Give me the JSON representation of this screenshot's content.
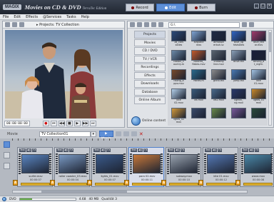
{
  "app": {
    "logo": "MAGIX",
    "title": "Movies on CD & DVD",
    "edition": "TerraTec Edition",
    "modes": [
      {
        "label": "Record",
        "active": false
      },
      {
        "label": "Edit",
        "active": true
      },
      {
        "label": "Burn",
        "active": false
      }
    ]
  },
  "menu": [
    "File",
    "Edit",
    "Effects",
    "@Services",
    "Tasks",
    "Help"
  ],
  "preview": {
    "breadcrumb": "▸ Projects: TV Collection",
    "timecode": "00:00:00:00",
    "transport": [
      "●",
      "⏮",
      "◀◀",
      "■",
      "▶",
      "▶▶",
      "⏭"
    ]
  },
  "pool": {
    "path": "G:\\",
    "categories": [
      "Projects",
      "Movies",
      "CD / DVD",
      "TV / VCR",
      "Recordings",
      "Effects",
      "Downloads",
      "Database",
      "Online Album"
    ],
    "active_category": "Projects",
    "online_label": "Online content",
    "files": [
      {
        "name": "3d_cars",
        "ext": "slides",
        "color": "#2b4a7a"
      },
      {
        "name": "airplane",
        "ext": "ntxs",
        "color": "#7fa5d4"
      },
      {
        "name": "atmosph",
        "ext": "erbuh.sc",
        "color": "#1f2a44"
      },
      {
        "name": "blue_lig",
        "ext": "htshades",
        "color": "#3066c4"
      },
      {
        "name": "blue_red",
        "ext": "ar.mxv",
        "color": "#a23c6c"
      },
      {
        "name": "classic_c",
        "ext": "ountry.m",
        "color": "#6c8aa8"
      },
      {
        "name": "colored_",
        "ext": "flakes.mxv",
        "color": "#c45a2a"
      },
      {
        "name": "crossing",
        "ext": "line.mxv",
        "color": "#5a6470"
      },
      {
        "name": "drive.mv",
        "ext": "",
        "color": "#8aa0b8"
      },
      {
        "name": "driving_a",
        "ext": "t_night.",
        "color": "#1a1e3a"
      },
      {
        "name": "falling_a",
        "ext": "pps.mxv",
        "color": "#7a4a2a"
      },
      {
        "name": "fishes.m",
        "ext": "",
        "color": "#2a6a8c"
      },
      {
        "name": "grind.mv",
        "ext": "",
        "color": "#8c8c8c"
      },
      {
        "name": "jump.mv",
        "ext": "",
        "color": "#4a7ab4"
      },
      {
        "name": "kite",
        "ext": "01.mxv",
        "color": "#a4c4e4"
      },
      {
        "name": "kite",
        "ext": "02.mxv",
        "color": "#b4d0ea"
      },
      {
        "name": "lift.mxv",
        "ext": "",
        "color": "#3a5a7a"
      },
      {
        "name": "lift2.mxv",
        "ext": "",
        "color": "#4a6a8a"
      },
      {
        "name": "lightni_",
        "ext": "ng.mxv",
        "color": "#2a3a6a"
      },
      {
        "name": "lights_01",
        "ext": "mxv",
        "color": "#ca8a2a"
      },
      {
        "name": "lights_02",
        "ext": "mxv",
        "color": "#d49a3a"
      },
      {
        "name": "",
        "ext": "",
        "color": "#3a4a6a"
      },
      {
        "name": "",
        "ext": "",
        "color": "#6a8a4a"
      },
      {
        "name": "",
        "ext": "",
        "color": "#7a5a9a"
      },
      {
        "name": "",
        "ext": "",
        "color": "#2a4a3a"
      }
    ]
  },
  "storyboard": {
    "movie_label": "Movie",
    "movie_name": "TV Collection01",
    "mode_button": "▶ Movie",
    "clips": [
      {
        "name": "surfer.mxv",
        "duration": "00:00:07",
        "color": "#5a86c2",
        "selected": false
      },
      {
        "name": "roller coaster_03.mxv",
        "duration": "00:00:04",
        "color": "#7a9ac4",
        "selected": false
      },
      {
        "name": "lights_01.mxv",
        "duration": "00:00:07",
        "color": "#3a5a8a",
        "selected": false
      },
      {
        "name": "para 02.mxv",
        "duration": "00:00:11",
        "color": "#c8783a",
        "selected": true
      },
      {
        "name": "subway.mxv",
        "duration": "00:00:10",
        "color": "#9aa4b0",
        "selected": false
      },
      {
        "name": "kite 01.mxv",
        "duration": "00:00:12",
        "color": "#5478b4",
        "selected": false
      },
      {
        "name": "wave.mxv",
        "duration": "00:00:08",
        "color": "#4a88a8",
        "selected": false
      }
    ]
  },
  "status": {
    "disc": "DVD",
    "used": "4.68",
    "total": "40 MB",
    "quality": "Qualität 3"
  }
}
